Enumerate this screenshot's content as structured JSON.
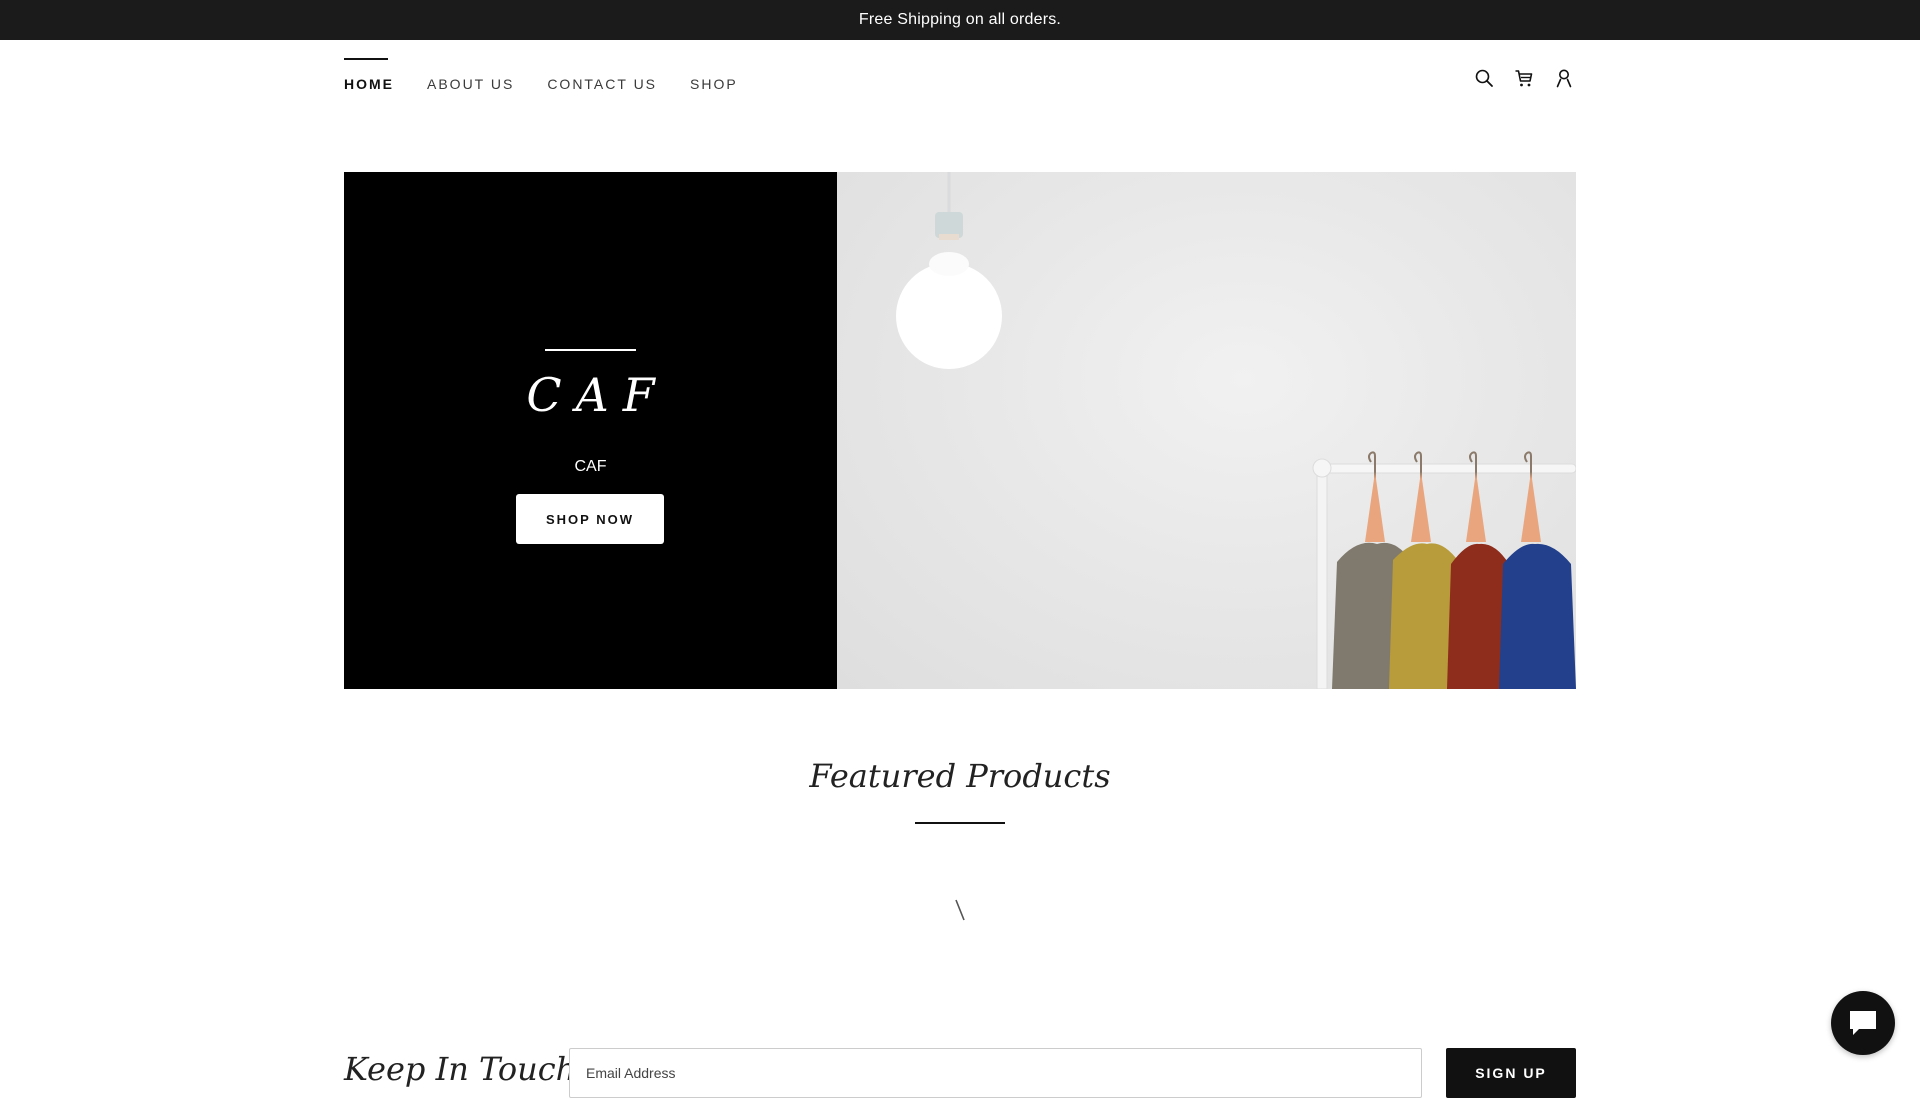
{
  "announcement": {
    "text": "Free Shipping on all orders."
  },
  "nav": {
    "items": [
      {
        "label": "HOME",
        "active": true
      },
      {
        "label": "ABOUT US",
        "active": false
      },
      {
        "label": "CONTACT US",
        "active": false
      },
      {
        "label": "SHOP",
        "active": false
      }
    ]
  },
  "header_icons": [
    "search-icon",
    "cart-icon",
    "account-icon"
  ],
  "hero": {
    "title": "CAF",
    "subtitle": "CAF",
    "button_label": "SHOP NOW",
    "image_subject": "clothing-rack-with-sweaters-and-light-bulb"
  },
  "featured": {
    "title": "Featured Products"
  },
  "newsletter": {
    "title": "Keep In Touch",
    "email_placeholder": "Email Address",
    "button_label": "SIGN UP"
  },
  "chat": {
    "icon": "chat-icon"
  },
  "colors": {
    "announcement_bg": "#1b1b1b",
    "hero_panel_bg": "#000000",
    "accent": "#111111",
    "page_bg": "#ffffff"
  }
}
